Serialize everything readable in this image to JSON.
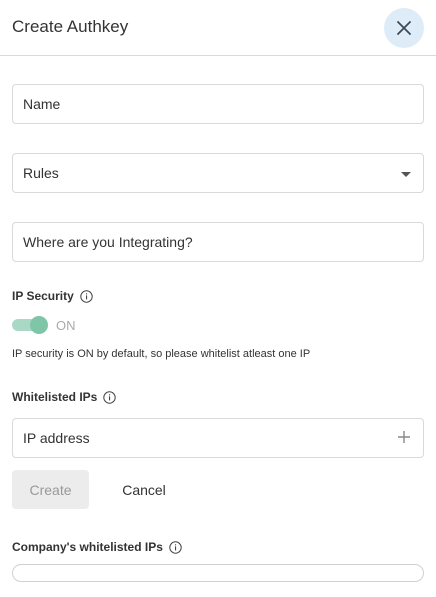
{
  "header": {
    "title": "Create Authkey",
    "close_icon": "close-icon"
  },
  "form": {
    "name_placeholder": "Name",
    "rules_label": "Rules",
    "integration_placeholder": "Where are you Integrating?"
  },
  "ip_security": {
    "label": "IP Security",
    "toggle_state": "ON",
    "toggle_on": true,
    "note": "IP security is ON by default, so please whitelist atleast one IP"
  },
  "whitelisted": {
    "label": "Whitelisted IPs",
    "ip_placeholder": "IP address",
    "add_icon": "plus-icon"
  },
  "actions": {
    "create_label": "Create",
    "cancel_label": "Cancel"
  },
  "company": {
    "label": "Company's whitelisted IPs"
  },
  "colors": {
    "close_bg": "#deecf7",
    "toggle_track": "#a9d8c4",
    "toggle_knob": "#7fc6a9",
    "create_disabled_bg": "#ececec"
  }
}
